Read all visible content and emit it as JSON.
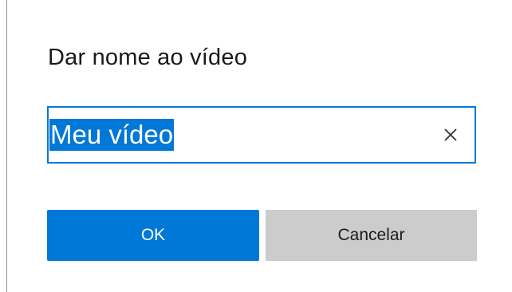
{
  "dialog": {
    "title": "Dar nome ao vídeo",
    "name_input": {
      "value": "Meu vídeo",
      "selected": true
    },
    "clear_icon": "close-icon",
    "ok_label": "OK",
    "cancel_label": "Cancelar"
  },
  "colors": {
    "accent": "#0078d7",
    "cancel_background": "#cccccc",
    "text": "#1a1a1a"
  }
}
